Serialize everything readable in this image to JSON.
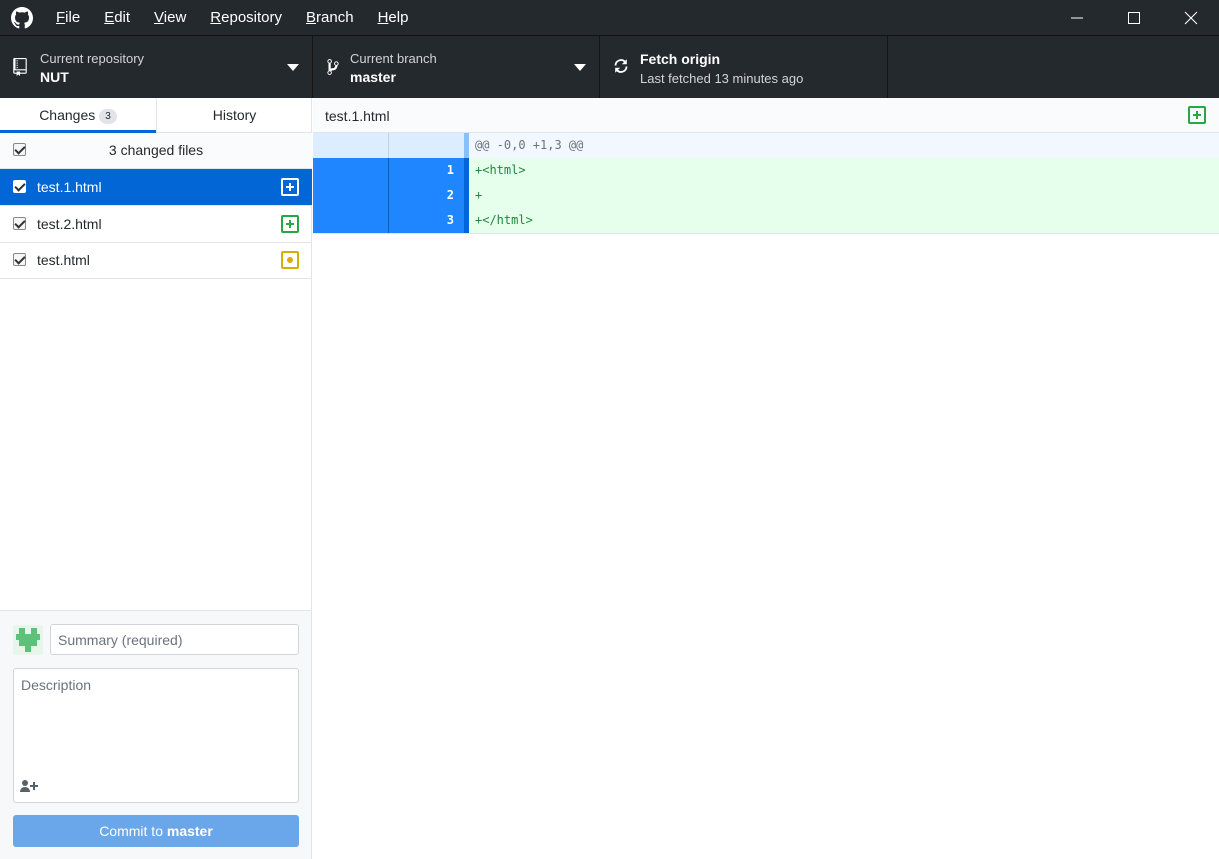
{
  "menu": {
    "items": [
      {
        "pre": "",
        "key": "F",
        "post": "ile"
      },
      {
        "pre": "",
        "key": "E",
        "post": "dit"
      },
      {
        "pre": "",
        "key": "V",
        "post": "iew"
      },
      {
        "pre": "",
        "key": "R",
        "post": "epository"
      },
      {
        "pre": "",
        "key": "B",
        "post": "ranch"
      },
      {
        "pre": "",
        "key": "H",
        "post": "elp"
      }
    ]
  },
  "window_controls": {
    "minimize_icon": "minimize-icon",
    "maximize_icon": "maximize-icon",
    "close_icon": "close-icon"
  },
  "toolbar": {
    "repository": {
      "label": "Current repository",
      "value": "NUT",
      "icon": "repo-icon"
    },
    "branch": {
      "label": "Current branch",
      "value": "master",
      "icon": "git-branch-icon"
    },
    "fetch": {
      "label": "Fetch origin",
      "detail": "Last fetched 13 minutes ago",
      "icon": "sync-icon"
    }
  },
  "tabs": {
    "changes": {
      "label": "Changes",
      "count": "3"
    },
    "history": {
      "label": "History"
    }
  },
  "files": {
    "header": "3 changed files",
    "list": [
      {
        "name": "test.1.html",
        "status": "added",
        "selected": true
      },
      {
        "name": "test.2.html",
        "status": "added",
        "selected": false
      },
      {
        "name": "test.html",
        "status": "modified",
        "selected": false
      }
    ]
  },
  "commit": {
    "summary_placeholder": "Summary (required)",
    "description_placeholder": "Description",
    "button_prefix": "Commit to ",
    "button_branch": "master"
  },
  "diff": {
    "path": "test.1.html",
    "hunk_header": "@@ -0,0 +1,3 @@",
    "lines": [
      {
        "num": "1",
        "text": "+<html>"
      },
      {
        "num": "2",
        "text": "+"
      },
      {
        "num": "3",
        "text": "+</html>"
      }
    ]
  },
  "colors": {
    "accent": "#0366d6",
    "added": "#28a745",
    "modified": "#dbab09",
    "titlebar": "#24292e",
    "commit_button": "#6aa7ea"
  }
}
